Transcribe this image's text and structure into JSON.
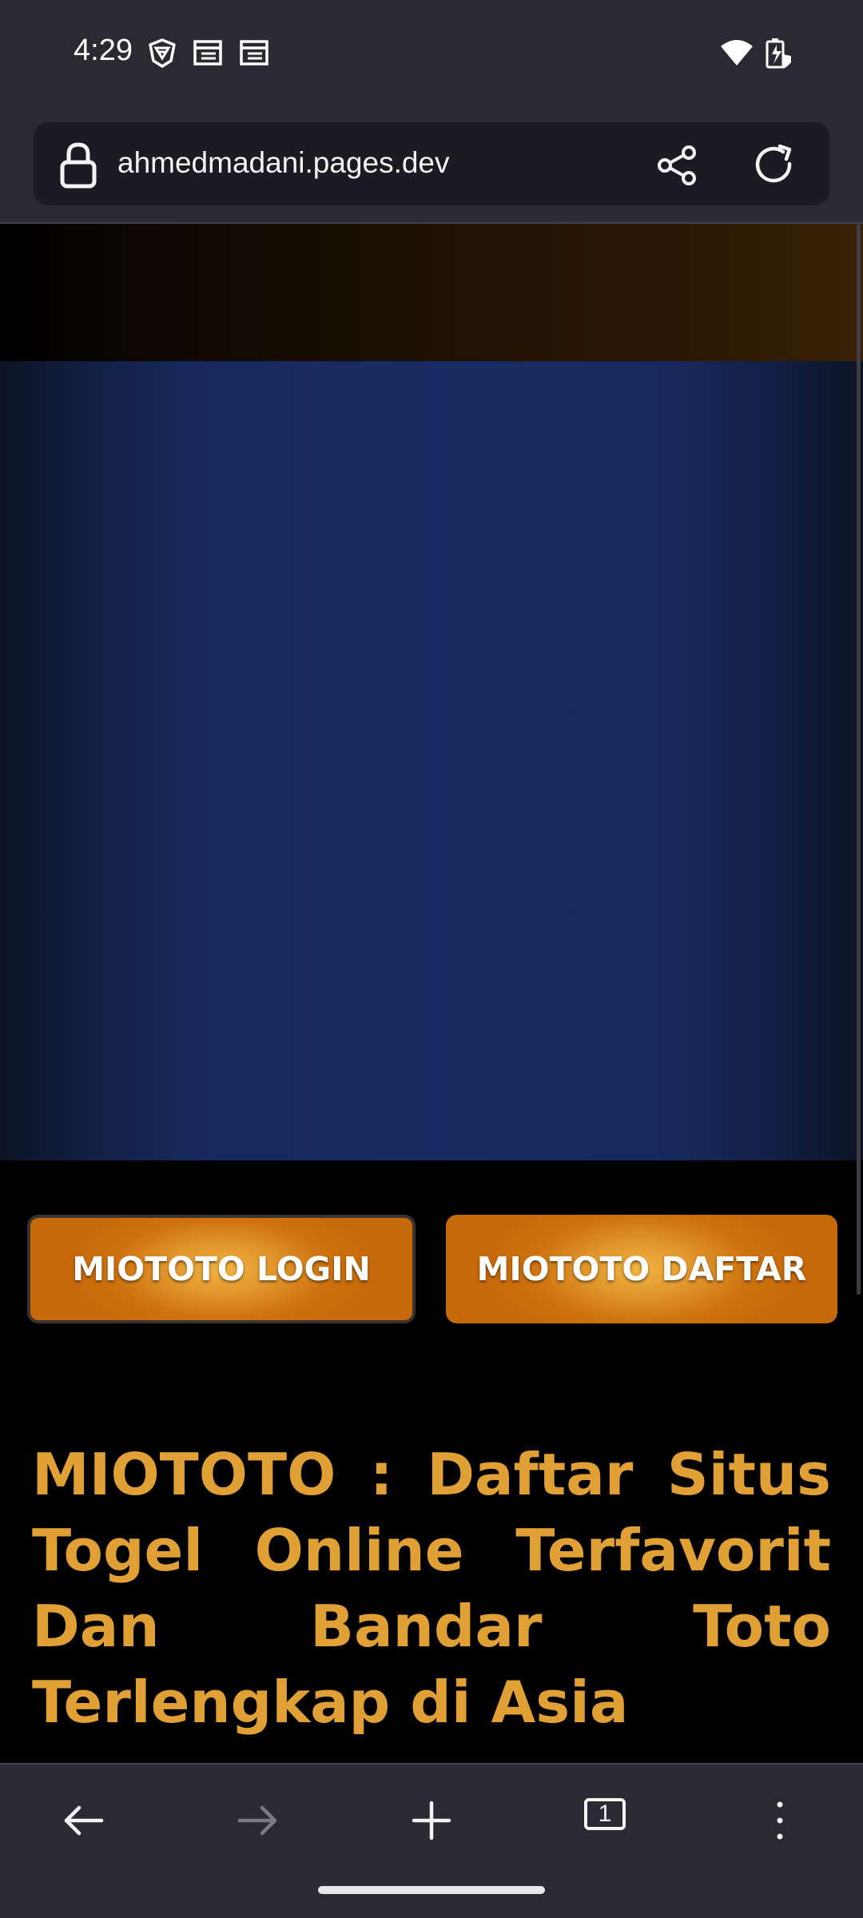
{
  "status_bar": {
    "time": "4:29",
    "left_icons": [
      "vpn-shield-icon",
      "calendar-icon",
      "calendar-icon"
    ],
    "right_icons": [
      "wifi-icon",
      "battery-icon"
    ]
  },
  "browser": {
    "url": "ahmedmadani.pages.dev",
    "icons": [
      "lock-icon",
      "share-icon",
      "reload-icon"
    ],
    "tab_count": "1"
  },
  "page": {
    "login_button": "MIOTOTO LOGIN",
    "daftar_button": "MIOTOTO DAFTAR",
    "headline": "MIOTOTO : Daftar Situs Togel Online Terfavorit Dan Bandar Toto Terlengkap di Asia",
    "colors": {
      "headline": "#e0a035",
      "button": "#cd720f",
      "banner": "#182c63"
    }
  },
  "bottom_toolbar": {
    "icons": [
      "back-icon",
      "forward-icon",
      "new-tab-icon",
      "tab-counter-icon",
      "menu-icon"
    ]
  }
}
